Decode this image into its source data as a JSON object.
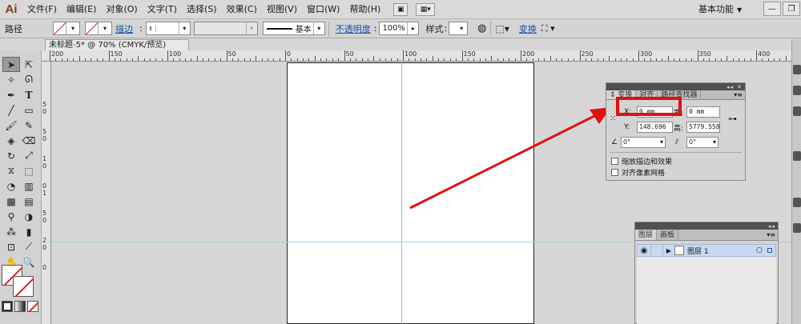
{
  "app": {
    "logo": "Ai"
  },
  "menu": [
    "文件(F)",
    "编辑(E)",
    "对象(O)",
    "文字(T)",
    "选择(S)",
    "效果(C)",
    "视图(V)",
    "窗口(W)",
    "帮助(H)"
  ],
  "workspace": {
    "label": "基本功能"
  },
  "control_bar": {
    "path_label": "路径",
    "stroke_link": "描边",
    "stroke_style": "基本",
    "opacity_link": "不透明度",
    "opacity_value": "100%",
    "style_label": "样式",
    "transform_link": "变换"
  },
  "document": {
    "tab_title": "未标题-5* @ 70% (CMYK/预览)"
  },
  "ruler": {
    "top_labels": [
      "200",
      "150",
      "100",
      "50",
      "0",
      "50",
      "100",
      "150",
      "200",
      "250",
      "300",
      "350",
      "400"
    ],
    "left_labels": [
      "5",
      "0",
      "5",
      "0",
      "1",
      "0",
      "0",
      "1",
      "5",
      "0",
      "2",
      "0",
      "0"
    ]
  },
  "transform_panel": {
    "tabs": [
      "变换",
      "对齐",
      "路径查找器"
    ],
    "x_label": "X:",
    "x_value": "0 mm",
    "w_label": "宽:",
    "w_value": "0 mm",
    "y_label": "Y:",
    "y_value": "148.696",
    "h_label": "高:",
    "h_value": "5779.558",
    "angle_value": "0°",
    "shear_value": "0°",
    "checkbox_scale": "缩放描边和效果",
    "checkbox_align": "对齐像素网格"
  },
  "layers_panel": {
    "tabs": [
      "图层",
      "画板"
    ],
    "layer_name": "图层 1"
  },
  "colors": {
    "accent_red": "#e01010",
    "guide_cyan": "#8fd8e8",
    "link_blue": "#1a4fa8"
  }
}
